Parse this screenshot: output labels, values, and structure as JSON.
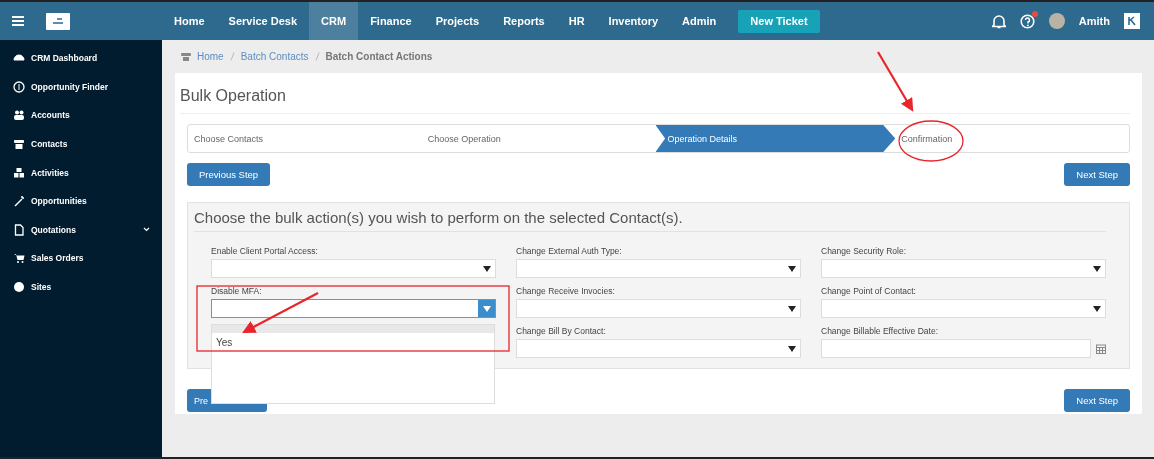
{
  "topbar": {
    "menu": [
      {
        "label": "Home",
        "selected": false
      },
      {
        "label": "Service Desk",
        "selected": false
      },
      {
        "label": "CRM",
        "selected": true
      },
      {
        "label": "Finance",
        "selected": false
      },
      {
        "label": "Projects",
        "selected": false
      },
      {
        "label": "Reports",
        "selected": false
      },
      {
        "label": "HR",
        "selected": false
      },
      {
        "label": "Inventory",
        "selected": false
      },
      {
        "label": "Admin",
        "selected": false
      }
    ],
    "new_ticket": "New Ticket",
    "help_alert": true,
    "user": "Amith"
  },
  "sidebar": {
    "items": [
      {
        "label": "CRM Dashboard",
        "has_submenu": false
      },
      {
        "label": "Opportunity Finder",
        "has_submenu": false
      },
      {
        "label": "Accounts",
        "has_submenu": false
      },
      {
        "label": "Contacts",
        "has_submenu": false
      },
      {
        "label": "Activities",
        "has_submenu": false
      },
      {
        "label": "Opportunities",
        "has_submenu": false
      },
      {
        "label": "Quotations",
        "has_submenu": true
      },
      {
        "label": "Sales Orders",
        "has_submenu": false
      },
      {
        "label": "Sites",
        "has_submenu": false
      }
    ]
  },
  "breadcrumb": [
    {
      "label": "Home",
      "link": true
    },
    {
      "label": "Batch Contacts",
      "link": true
    },
    {
      "label": "Batch Contact Actions",
      "link": false
    }
  ],
  "title": "Bulk Operation",
  "steps": [
    {
      "label": "Choose Contacts",
      "selected": false
    },
    {
      "label": "Choose Operation",
      "selected": false
    },
    {
      "label": "Operation Details",
      "selected": true
    },
    {
      "label": "Confirmation",
      "selected": false
    }
  ],
  "previous_button": "Previous Step",
  "next_button": "Next Step",
  "section_heading": "Choose the bulk action(s) you wish to perform on the selected Contact(s).",
  "fields": [
    {
      "label": "Enable Client Portal Access:",
      "kind": "select",
      "open": false
    },
    {
      "label": "Change External Auth Type:",
      "kind": "select",
      "open": false
    },
    {
      "label": "Change Security Role:",
      "kind": "select",
      "open": false
    },
    {
      "label": "Disable MFA:",
      "kind": "select",
      "open": true,
      "options": [
        "Yes"
      ]
    },
    {
      "label": "Change Receive Invocies:",
      "kind": "select",
      "open": false
    },
    {
      "label": "Change Point of Contact:",
      "kind": "select",
      "open": false
    },
    {
      "label": "Change Bill By Contact:",
      "kind": "select",
      "open": false
    },
    {
      "label": "Change Billable Effective Date:",
      "kind": "date",
      "open": false
    }
  ],
  "bottom_previous_button": "Pre",
  "bottom_next_button": "Next Step"
}
